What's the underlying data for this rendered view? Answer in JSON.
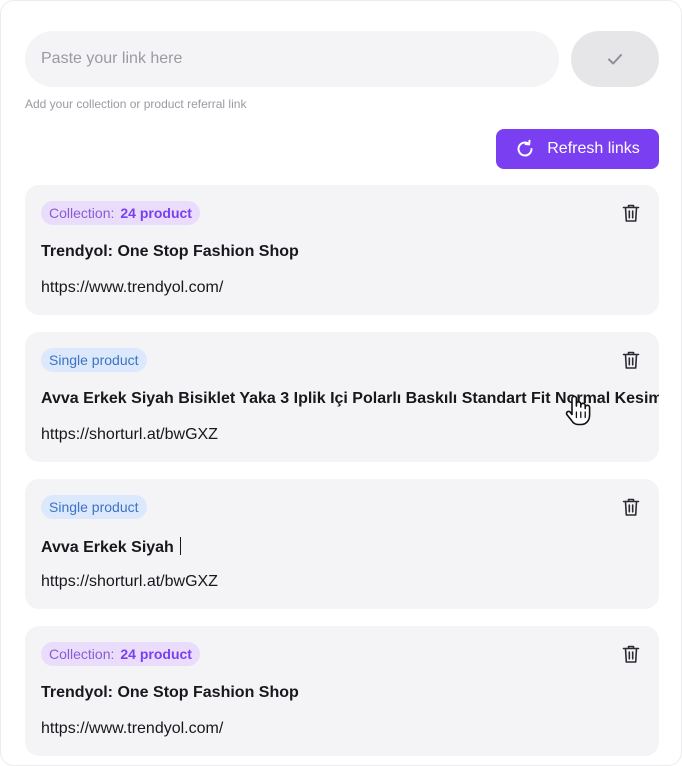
{
  "input": {
    "placeholder": "Paste your link here",
    "value": "",
    "hint": "Add your collection or product referral link"
  },
  "icons": {
    "submit": "check-icon",
    "refresh": "refresh-icon",
    "delete": "trash-icon",
    "cursor": "hand-pointer-icon"
  },
  "refresh_label": "Refresh links",
  "colors": {
    "accent": "#7b3ff2",
    "collection_badge_bg": "#e9ddfb",
    "single_badge_bg": "#dce8fb",
    "card_bg": "#f4f4f7"
  },
  "cards": [
    {
      "type": "collection",
      "badge_label": "Collection:",
      "badge_count": "24 product",
      "title": "Trendyol: One Stop Fashion Shop",
      "url": "https://www.trendyol.com/"
    },
    {
      "type": "single",
      "badge_label": "Single product",
      "title": "Avva Erkek Siyah Bisiklet Yaka 3 Iplik Içi Polarlı Baskılı Standart Fit Normal Kesim",
      "url": "https://shorturl.at/bwGXZ"
    },
    {
      "type": "single",
      "badge_label": "Single product",
      "title": "Avva Erkek Siyah",
      "url": "https://shorturl.at/bwGXZ"
    },
    {
      "type": "collection",
      "badge_label": "Collection:",
      "badge_count": "24 product",
      "title": "Trendyol: One Stop Fashion Shop",
      "url": "https://www.trendyol.com/"
    }
  ]
}
